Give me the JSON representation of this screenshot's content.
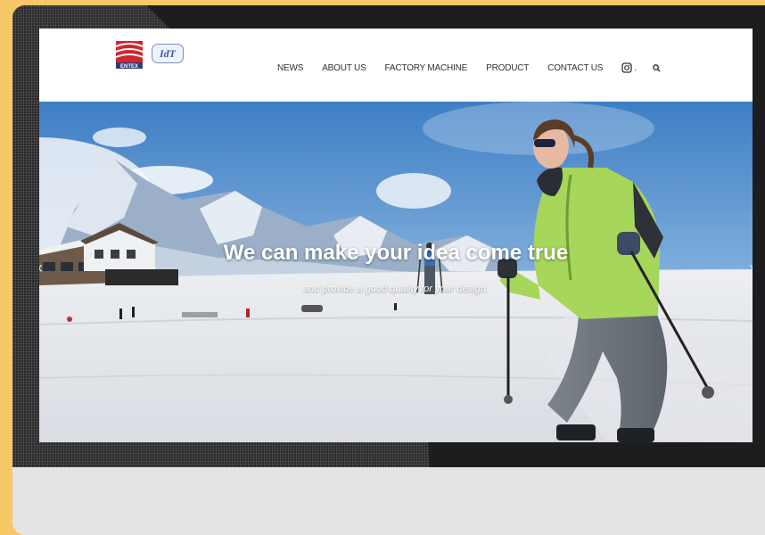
{
  "header": {
    "logo_entex_text": "ENTEX",
    "logo_idt_text": "IdT"
  },
  "nav": {
    "items": [
      "NEWS",
      "ABOUT US",
      "FACTORY MACHINE",
      "PRODUCT",
      "CONTACT US"
    ],
    "dot": "."
  },
  "hero": {
    "title": "We can make your idea come true",
    "subtitle": "and provide a good quality for your design.",
    "prev_arrow": "‹",
    "next_arrow": "›"
  },
  "colors": {
    "background_yellow": "#f7c866",
    "device_frame": "#1d1d1f",
    "backdrop_gray": "#e4e4e6",
    "jacket_green": "#a6d65a",
    "entex_red": "#d0262a"
  },
  "icons": [
    "instagram-icon",
    "search-icon",
    "chevron-left-icon",
    "chevron-right-icon"
  ]
}
